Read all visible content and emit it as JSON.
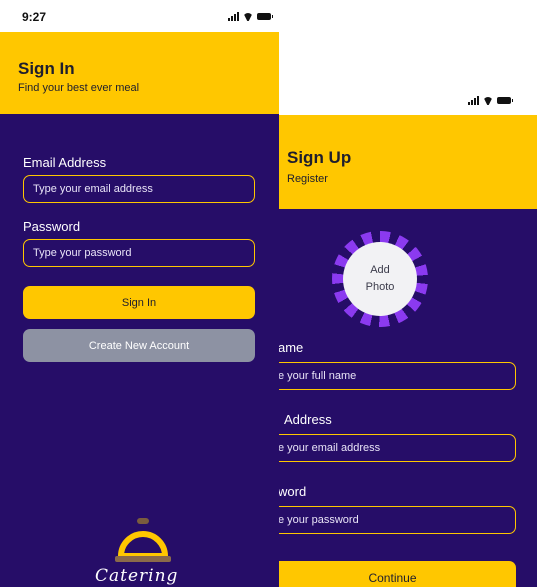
{
  "signin_screen": {
    "status_time": "9:27",
    "title": "Sign In",
    "subtitle": "Find your best ever meal",
    "email_label": "Email Address",
    "email_placeholder": "Type your email address",
    "password_label": "Password",
    "password_placeholder": "Type your password",
    "signin_button": "Sign In",
    "create_account_button": "Create New Account",
    "logo_text": "Catering"
  },
  "signup_screen": {
    "title": "Sign Up",
    "subtitle": "Register",
    "photo_line1": "Add",
    "photo_line2": "Photo",
    "name_label": "ame",
    "name_placeholder": "e your full name",
    "email_label": "Address",
    "email_placeholder": "e your email address",
    "password_label": "word",
    "password_placeholder": "e your password",
    "continue_button": "Continue"
  },
  "colors": {
    "accent_yellow": "#FFC700",
    "background_purple": "#260D68",
    "disabled_grey": "#8D92A3",
    "photo_ring": "#8B3AF0"
  },
  "icons": [
    "signal-icon",
    "wifi-icon",
    "battery-icon",
    "bell-logo-icon"
  ]
}
